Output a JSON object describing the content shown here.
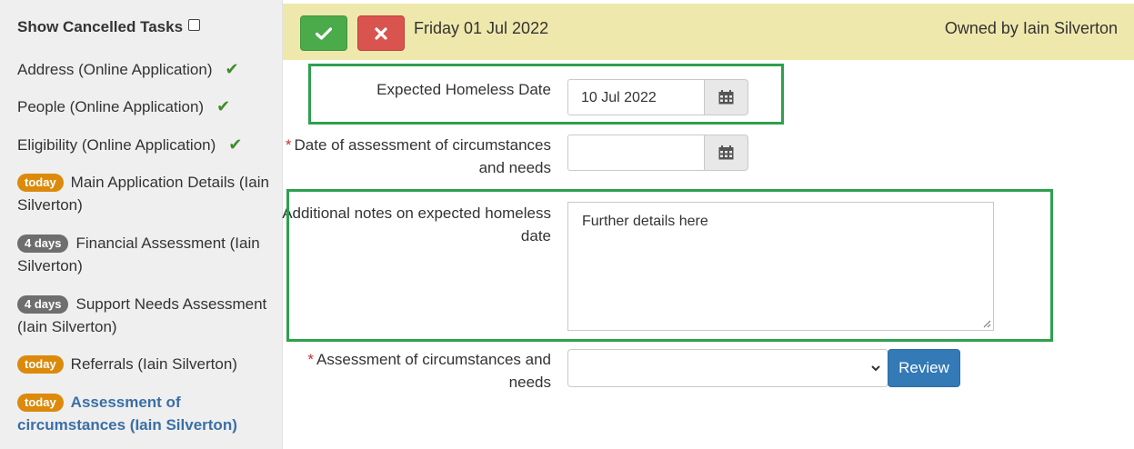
{
  "sidebar": {
    "show_cancelled_label": "Show Cancelled Tasks",
    "tasks": [
      {
        "label": "Address (Online Application)",
        "done": true
      },
      {
        "label": "People (Online Application)",
        "done": true
      },
      {
        "label": "Eligibility (Online Application)",
        "done": true
      },
      {
        "badge": "today",
        "label": "Main Application Details (Iain Silverton)"
      },
      {
        "badge": "4 days",
        "label": "Financial Assessment (Iain Silverton)"
      },
      {
        "badge": "4 days",
        "label": "Support Needs Assessment (Iain Silverton)"
      },
      {
        "badge": "today",
        "label": "Referrals (Iain Silverton)"
      },
      {
        "badge": "today",
        "label": "Assessment of circumstances (Iain Silverton)",
        "active": true
      }
    ],
    "check_glyph": "✔"
  },
  "header": {
    "date": "Friday 01 Jul 2022",
    "owner": "Owned by Iain Silverton",
    "confirm_icon": "check-icon",
    "cancel_icon": "close-icon"
  },
  "form": {
    "expected_date_label": "Expected Homeless Date",
    "expected_date_value": "10 Jul 2022",
    "assessment_date_label_l1": "Date of assessment of circumstances",
    "assessment_date_label_l2": "and needs",
    "assessment_date_value": "",
    "notes_label_l1": "Additional notes on expected homeless",
    "notes_label_l2": "date",
    "notes_value": "Further details here",
    "assessment_label_l1": "Assessment of circumstances and",
    "assessment_label_l2": "needs",
    "assessment_selected": "",
    "review_label": "Review",
    "required_mark": "*"
  },
  "colors": {
    "header_bg": "#efe8ac",
    "confirm_green": "#4bab4b",
    "cancel_red": "#d9534f",
    "today_badge": "#dc8a0c",
    "days_badge": "#6e6e6e",
    "highlight": "#2ea04e",
    "review_blue": "#337ab7"
  }
}
